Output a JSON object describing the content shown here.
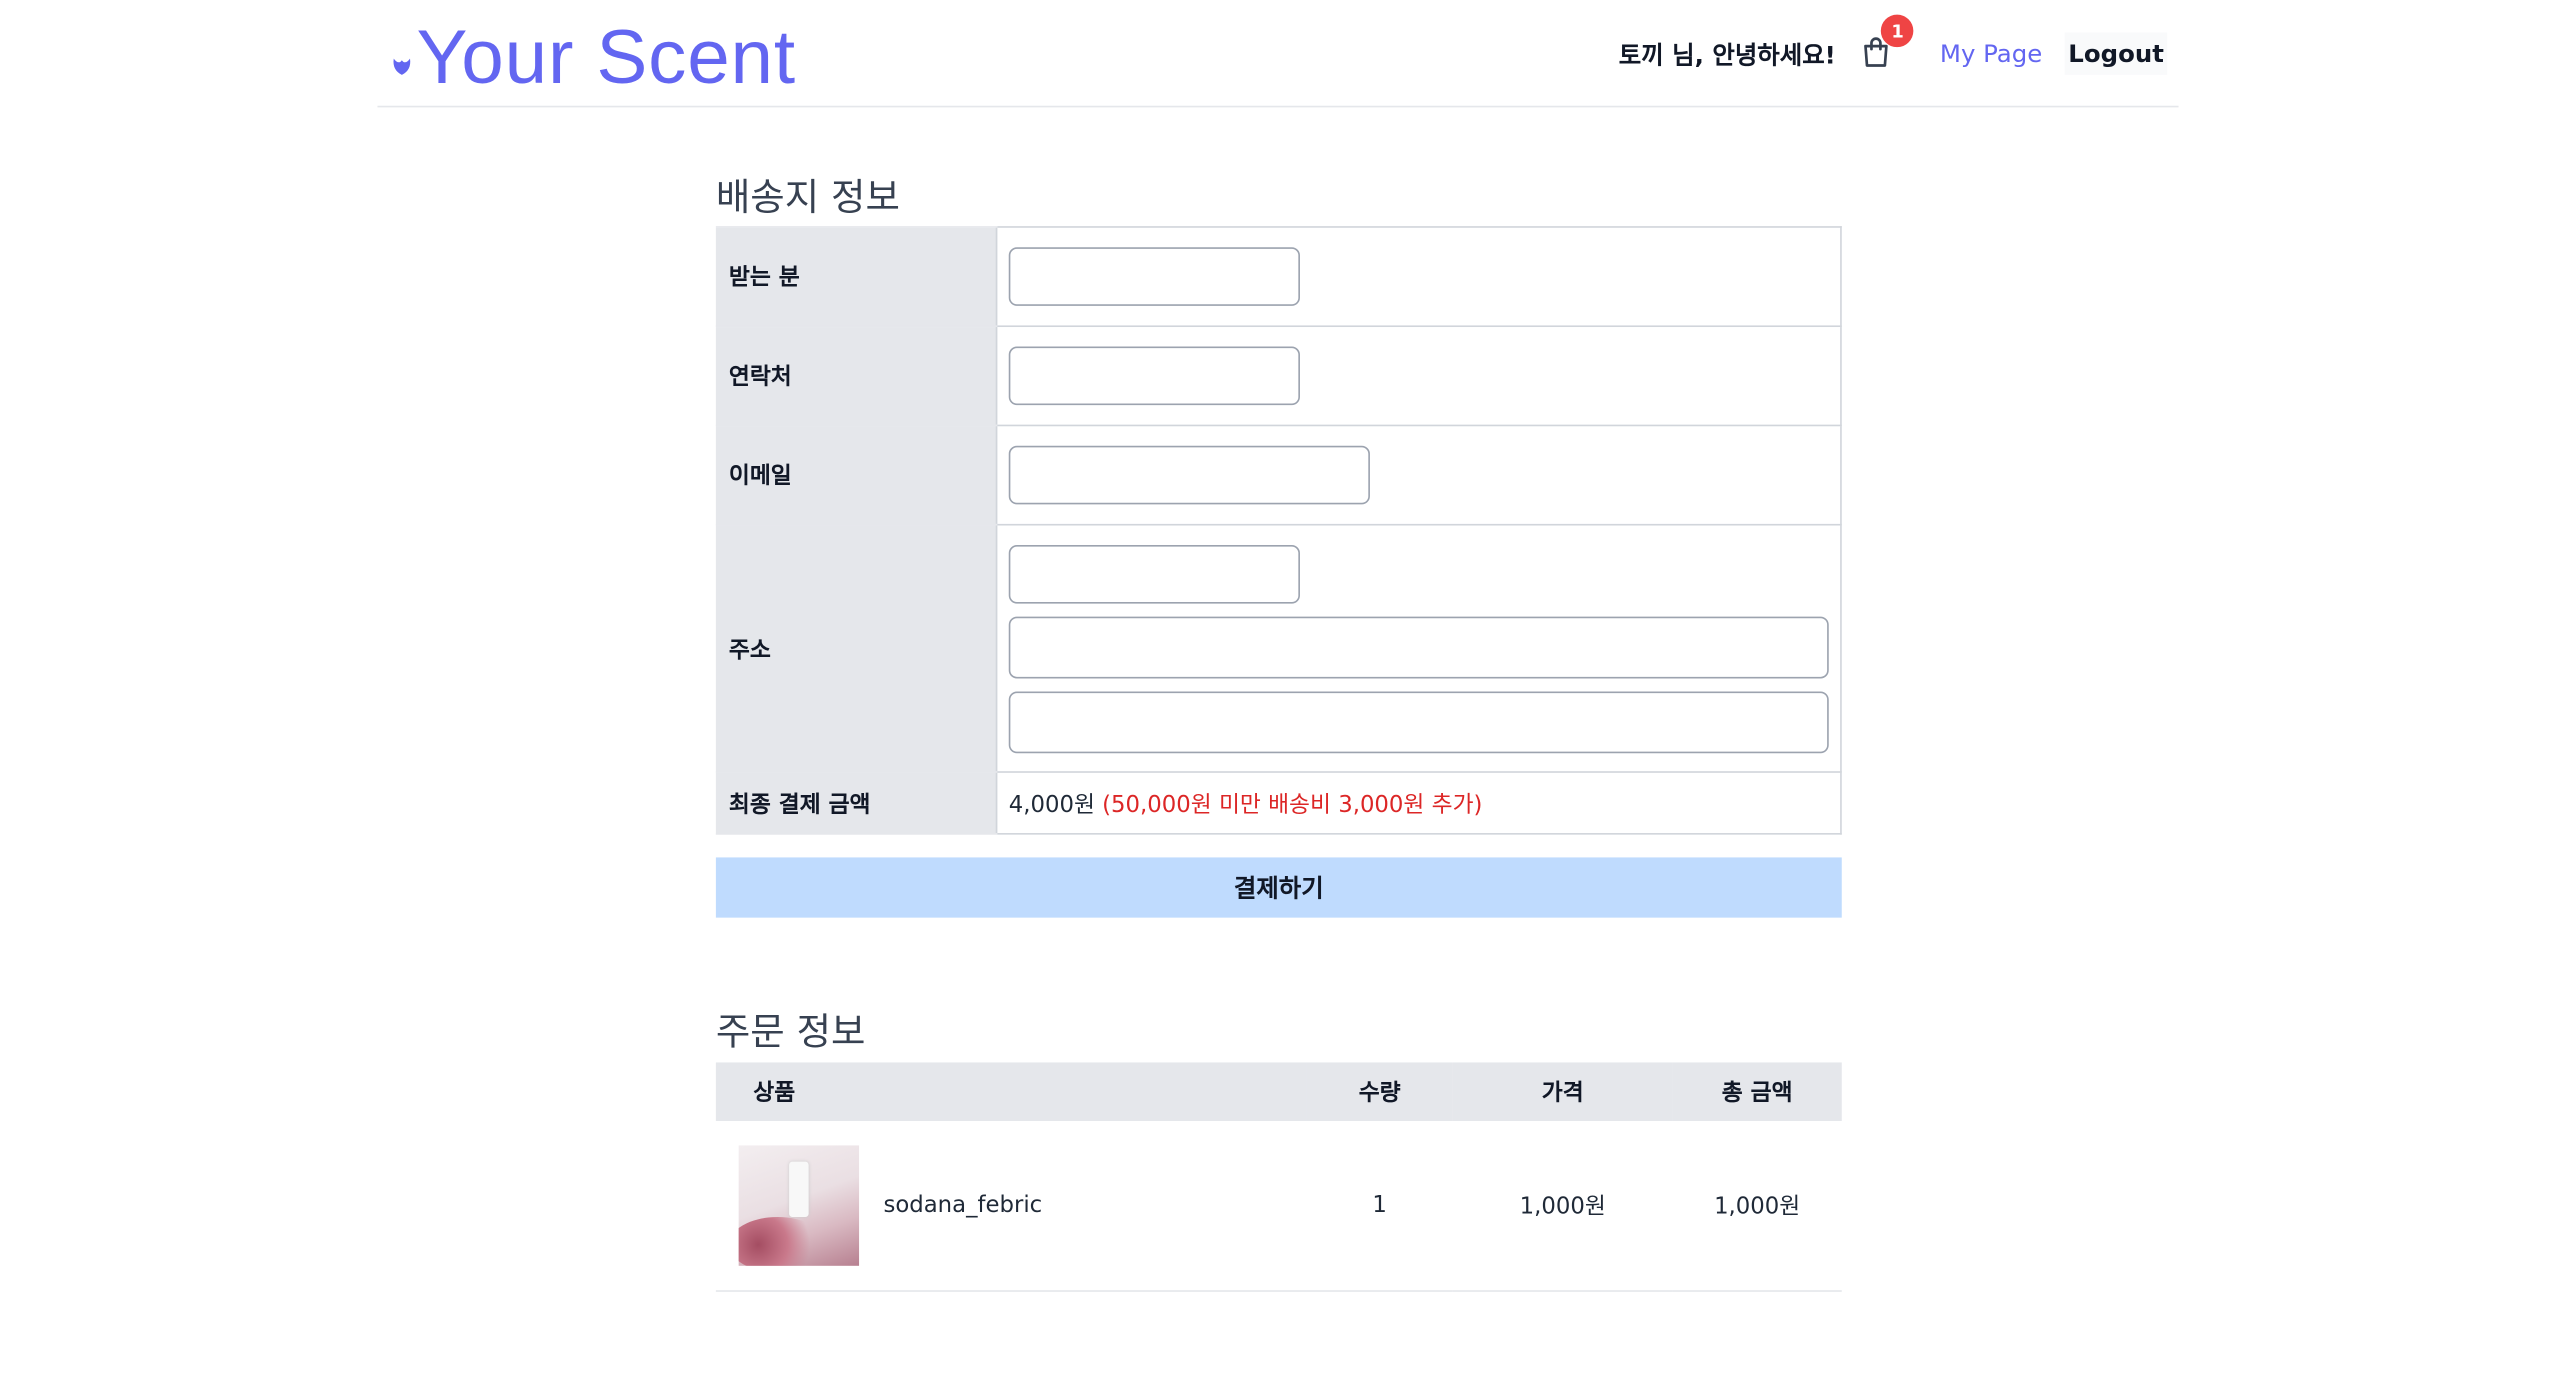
{
  "header": {
    "brand": "Your Scent",
    "greeting": "토끼 님, 안녕하세요!",
    "cart_count": "1",
    "my_page": "My Page",
    "logout": "Logout"
  },
  "shipping": {
    "title": "배송지 정보",
    "rows": {
      "recipient_label": "받는 분",
      "phone_label": "연락처",
      "email_label": "이메일",
      "address_label": "주소",
      "total_label": "최종 결제 금액"
    },
    "total_value": "4,000원",
    "shipping_note": "(50,000원 미만 배송비 3,000원 추가)",
    "pay_button": "결제하기"
  },
  "order": {
    "title": "주문 정보",
    "columns": [
      "상품",
      "수량",
      "가격",
      "총 금액"
    ],
    "items": [
      {
        "name": "sodana_febric",
        "qty": "1",
        "price": "1,000원",
        "total": "1,000원"
      }
    ]
  },
  "colors": {
    "brand": "#6366f1",
    "badge": "#ef4444",
    "pay_button_bg": "#bfdbfe",
    "note": "#dc2626"
  },
  "icons": [
    "tulip-logo-icon",
    "shopping-bag-icon"
  ]
}
